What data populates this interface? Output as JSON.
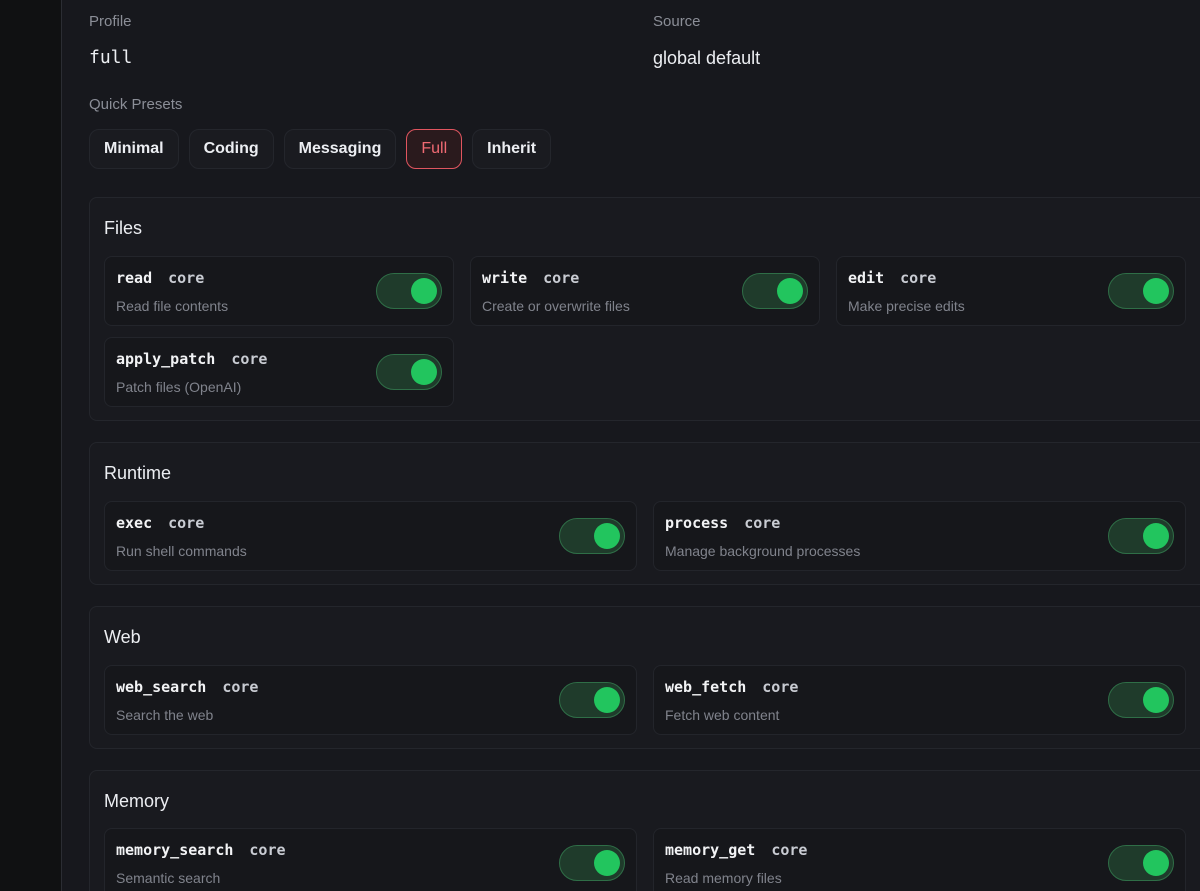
{
  "profile": {
    "label": "Profile",
    "value": "full"
  },
  "source": {
    "label": "Source",
    "value": "global default"
  },
  "presets": {
    "label": "Quick Presets",
    "items": [
      {
        "label": "Minimal"
      },
      {
        "label": "Coding"
      },
      {
        "label": "Messaging"
      },
      {
        "label": "Full",
        "active": true
      },
      {
        "label": "Inherit"
      }
    ]
  },
  "sections": [
    {
      "title": "Files",
      "tools": [
        {
          "name": "read",
          "tag": "core",
          "desc": "Read file contents",
          "enabled": true
        },
        {
          "name": "write",
          "tag": "core",
          "desc": "Create or overwrite files",
          "enabled": true
        },
        {
          "name": "edit",
          "tag": "core",
          "desc": "Make precise edits",
          "enabled": true
        },
        {
          "name": "apply_patch",
          "tag": "core",
          "desc": "Patch files (OpenAI)",
          "enabled": true
        }
      ]
    },
    {
      "title": "Runtime",
      "tools": [
        {
          "name": "exec",
          "tag": "core",
          "desc": "Run shell commands",
          "enabled": true
        },
        {
          "name": "process",
          "tag": "core",
          "desc": "Manage background processes",
          "enabled": true
        }
      ]
    },
    {
      "title": "Web",
      "tools": [
        {
          "name": "web_search",
          "tag": "core",
          "desc": "Search the web",
          "enabled": true
        },
        {
          "name": "web_fetch",
          "tag": "core",
          "desc": "Fetch web content",
          "enabled": true
        }
      ]
    },
    {
      "title": "Memory",
      "tools": [
        {
          "name": "memory_search",
          "tag": "core",
          "desc": "Semantic search",
          "enabled": true
        },
        {
          "name": "memory_get",
          "tag": "core",
          "desc": "Read memory files",
          "enabled": true
        }
      ]
    }
  ],
  "colors": {
    "accent_active": "#f06a73",
    "toggle_on": "#22c55e"
  }
}
